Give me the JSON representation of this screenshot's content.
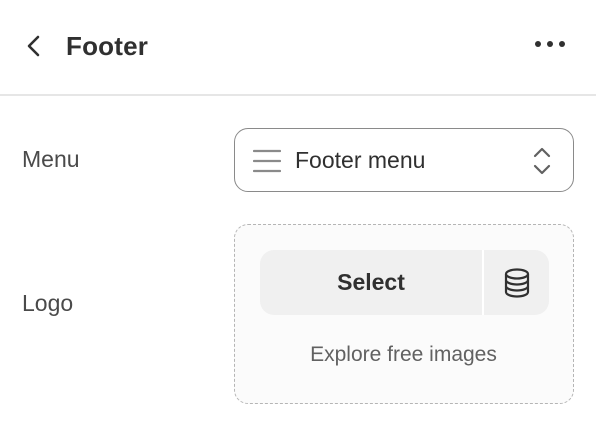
{
  "header": {
    "title": "Footer",
    "back_icon": "chevron-left-icon",
    "more_icon": "ellipsis-horizontal-icon"
  },
  "settings": {
    "menu": {
      "label": "Menu",
      "value": "Footer menu",
      "leading_icon": "menu-lines-icon",
      "trailing_icon": "select-updown-icon"
    },
    "logo": {
      "label": "Logo",
      "select_label": "Select",
      "library_icon": "database-icon",
      "explore_label": "Explore free images"
    }
  },
  "colors": {
    "text": "#303030",
    "label": "#4a4a4a",
    "muted": "#616161",
    "button_bg": "#f0f0f0",
    "border": "#8a8a8a",
    "dashed_border": "#b5b5b5",
    "divider": "#e6e6e6"
  }
}
